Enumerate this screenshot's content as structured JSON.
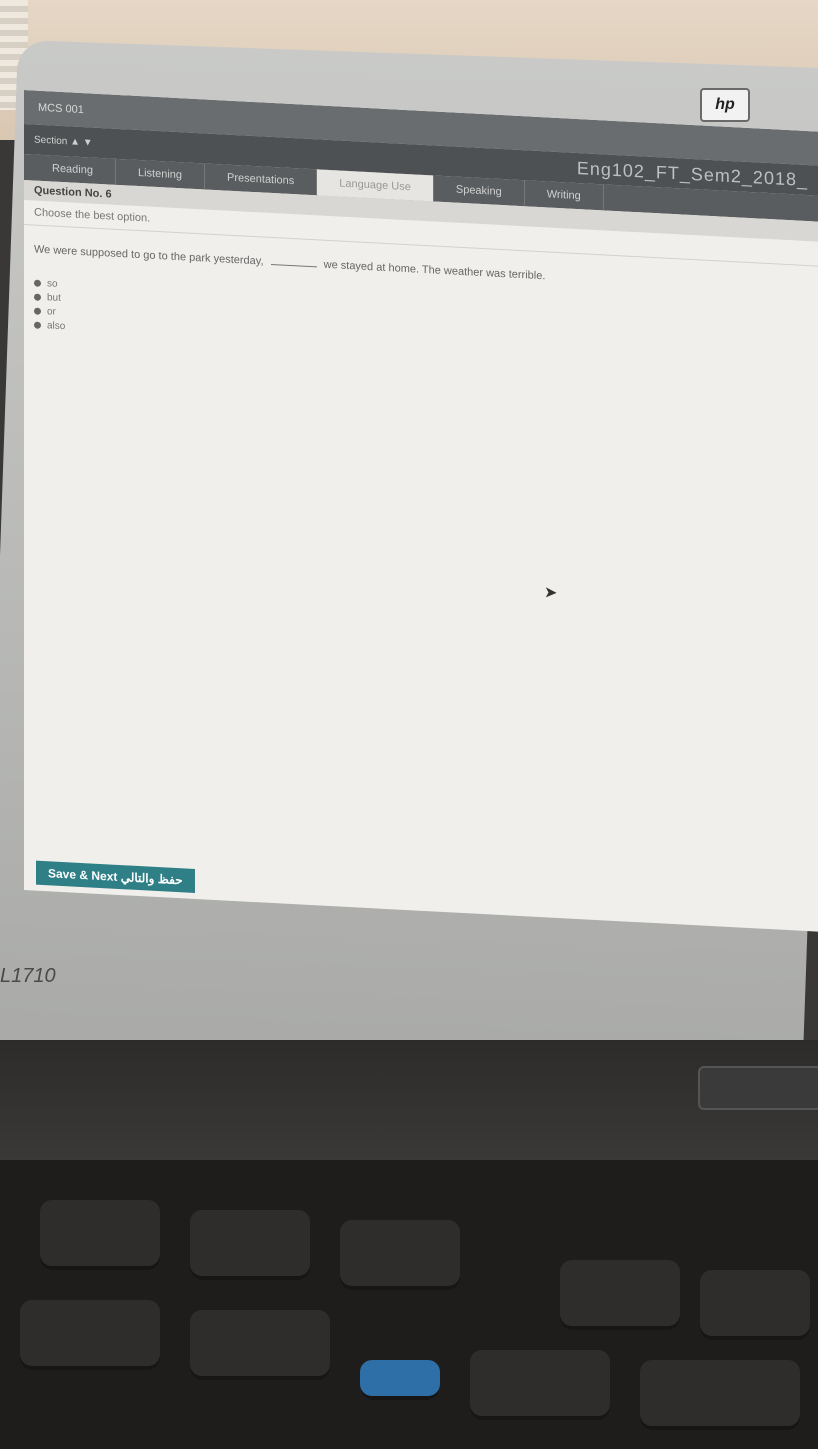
{
  "window": {
    "title": "MCS 001",
    "exam_title": "Eng102_FT_Sem2_2018_",
    "info_left": "Section ▲ ▼"
  },
  "tabs": [
    {
      "label": "Reading"
    },
    {
      "label": "Listening"
    },
    {
      "label": "Presentations"
    },
    {
      "label": "Language Use",
      "active": true
    },
    {
      "label": "Speaking"
    },
    {
      "label": "Writing"
    }
  ],
  "question": {
    "header": "Question No. 6",
    "instruction": "Choose the best option.",
    "text_before": "We were supposed to go to the park yesterday,",
    "text_after": "we stayed at home. The weather was terrible.",
    "options": [
      "so",
      "but",
      "or",
      "also"
    ]
  },
  "footer": {
    "save_label": "Save & Next حفظ والتالي"
  },
  "monitor": {
    "brand": "hp",
    "model": "L1710"
  },
  "colors": {
    "accent": "#2e7f86",
    "tab_bar": "#5a5d5f",
    "screen_bg": "#f1efec"
  }
}
